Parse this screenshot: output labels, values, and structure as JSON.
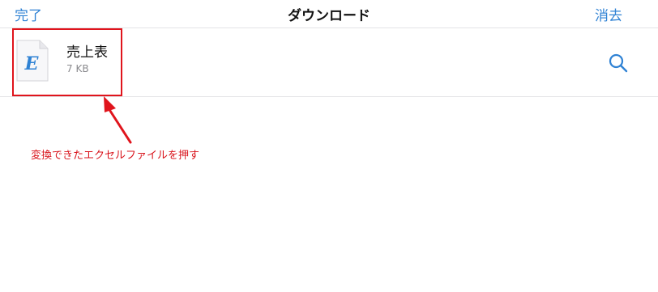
{
  "navbar": {
    "done_label": "完了",
    "title": "ダウンロード",
    "clear_label": "消去"
  },
  "file": {
    "icon": "excel-document-icon",
    "icon_letter": "E",
    "name": "売上表",
    "size": "7 KB"
  },
  "actions": {
    "search_icon": "search-icon"
  },
  "annotation": {
    "text": "変換できたエクセルファイルを押す",
    "color": "#e0141c"
  },
  "colors": {
    "accent": "#2f82d4",
    "highlight": "#e0141c"
  }
}
